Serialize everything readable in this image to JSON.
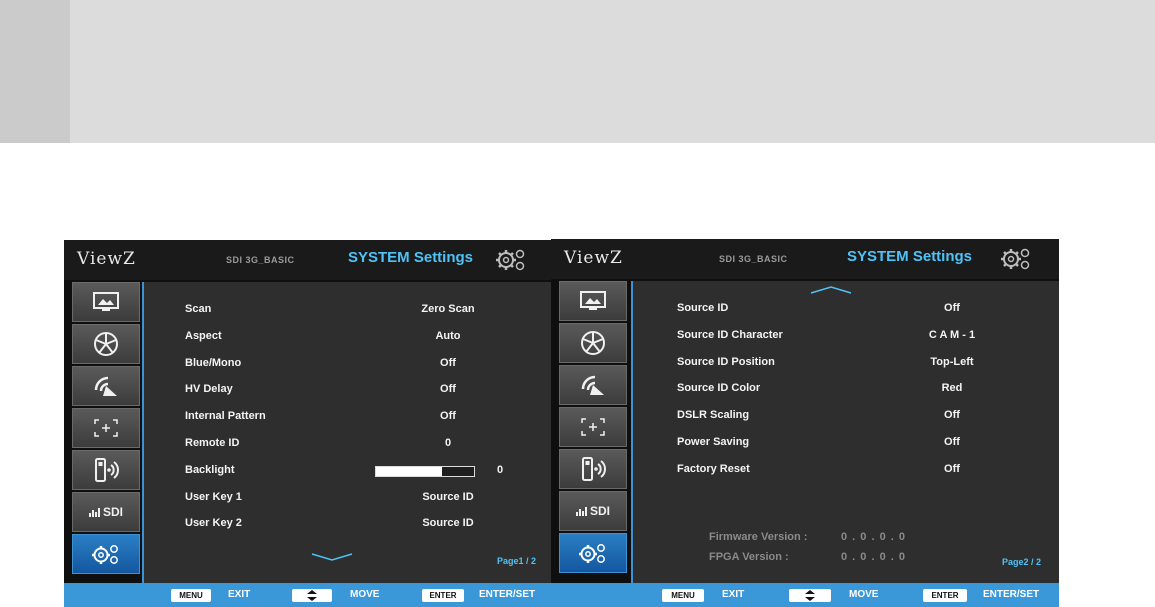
{
  "osd": {
    "logo": "ViewZ",
    "model": "SDI 3G_BASIC",
    "title": "SYSTEM Settings"
  },
  "sidebar": {
    "tabs": [
      {
        "icon": "picture-icon"
      },
      {
        "icon": "color-icon"
      },
      {
        "icon": "audio-icon"
      },
      {
        "icon": "crosshair-icon"
      },
      {
        "icon": "remote-icon"
      },
      {
        "icon": "sdi-icon",
        "label": "SDI"
      },
      {
        "icon": "gear-icon",
        "active": true
      }
    ]
  },
  "page1": {
    "rows": [
      {
        "label": "Scan",
        "value": "Zero Scan"
      },
      {
        "label": "Aspect",
        "value": "Auto"
      },
      {
        "label": "Blue/Mono",
        "value": "Off"
      },
      {
        "label": "HV Delay",
        "value": "Off"
      },
      {
        "label": "Internal Pattern",
        "value": "Off"
      },
      {
        "label": "Remote ID",
        "value": "0"
      },
      {
        "label": "Backlight",
        "value": "0",
        "bar_fraction": 0.67
      },
      {
        "label": "User Key 1",
        "value": "Source ID"
      },
      {
        "label": "User Key 2",
        "value": "Source ID"
      }
    ],
    "page_indicator": "Page1 / 2"
  },
  "page2": {
    "rows": [
      {
        "label": "Source ID",
        "value": "Off"
      },
      {
        "label": "Source ID Character",
        "value": "C A M - 1"
      },
      {
        "label": "Source ID Position",
        "value": "Top-Left"
      },
      {
        "label": "Source ID Color",
        "value": "Red"
      },
      {
        "label": "DSLR Scaling",
        "value": "Off"
      },
      {
        "label": "Power Saving",
        "value": "Off"
      },
      {
        "label": "Factory Reset",
        "value": "Off"
      }
    ],
    "firmware_label": "Firmware Version :",
    "firmware_value": "0 . 0 . 0 . 0",
    "fpga_label": "FPGA Version :",
    "fpga_value": "0 . 0 . 0 . 0",
    "page_indicator": "Page2 / 2"
  },
  "footer": {
    "menu_key": "MENU",
    "exit_label": "EXIT",
    "move_label": "MOVE",
    "enter_key": "ENTER",
    "enter_label": "ENTER/SET"
  },
  "colors": {
    "accent": "#4fc3f7",
    "footer": "#3a98d8",
    "active_tab": "#1f6fb8"
  }
}
